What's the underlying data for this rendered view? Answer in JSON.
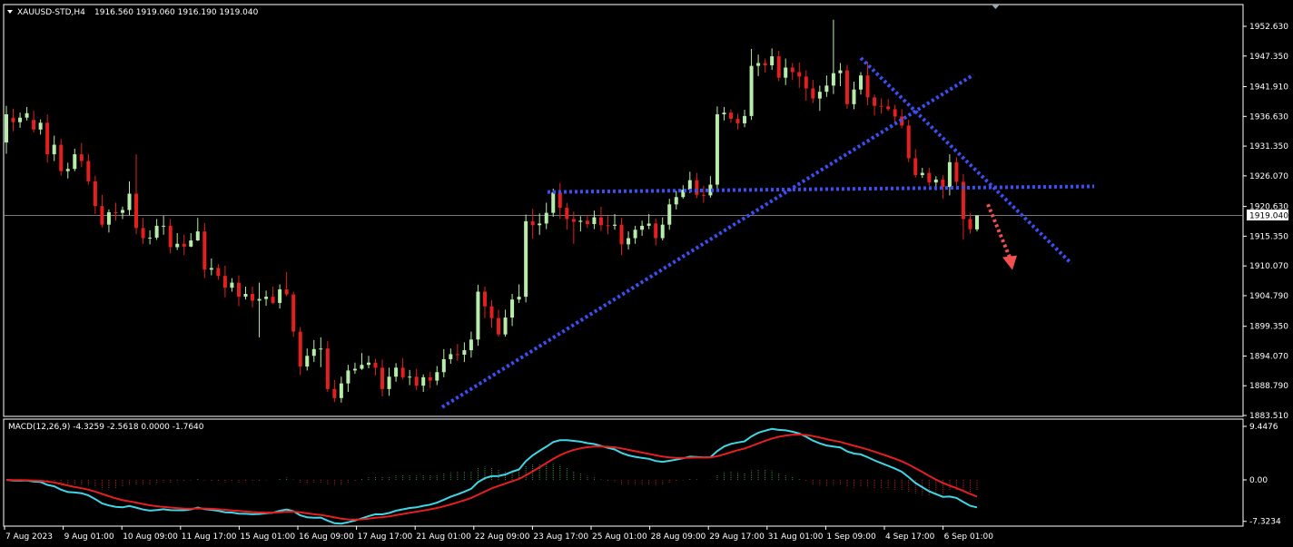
{
  "colors": {
    "background": "#000000",
    "frame": "#ffffff",
    "bull_candle": "#b7ecaa",
    "bear_candle": "#e41f1f",
    "trendline": "#3b4ff5",
    "arrow": "#f25050",
    "macd_line": "#40d6e6",
    "signal_line": "#e41f1f",
    "hist_pos": "#2f8f2f",
    "hist_neg": "#c41a1a",
    "price_line": "#a0a0a0"
  },
  "main_header": {
    "symbol_timeframe": "XAUUSD-STD,H4",
    "ohlc": "1916.560 1919.060 1916.190 1919.040"
  },
  "macd_header": {
    "text": "MACD(12,26,9) -4.3259 -2.5618 0.0000 -1.7640"
  },
  "current_price_label": "1919.040",
  "chart_data": [
    {
      "type": "candlestick",
      "title": "XAUUSD-STD,H4",
      "x_ticks": [
        "7 Aug 2023",
        "9 Aug 01:00",
        "10 Aug 09:00",
        "11 Aug 17:00",
        "15 Aug 01:00",
        "16 Aug 09:00",
        "17 Aug 17:00",
        "21 Aug 01:00",
        "22 Aug 09:00",
        "23 Aug 17:00",
        "25 Aug 01:00",
        "28 Aug 09:00",
        "29 Aug 17:00",
        "31 Aug 01:00",
        "1 Sep 09:00",
        "4 Sep 17:00",
        "6 Sep 01:00"
      ],
      "y_ticks": [
        "1952.630",
        "1947.350",
        "1941.910",
        "1936.630",
        "1931.350",
        "1926.070",
        "1920.630",
        "1915.350",
        "1910.070",
        "1904.790",
        "1899.350",
        "1894.070",
        "1888.790",
        "1883.510"
      ],
      "ylim": [
        1883.51,
        1955.5
      ],
      "current_price": 1919.04,
      "anchors": [
        1936,
        1936,
        1934,
        1927,
        1930,
        1921,
        1919,
        1915,
        1916,
        1921,
        1913,
        1915,
        1915,
        1909,
        1908,
        1905,
        1905,
        1903,
        1905,
        1902,
        1892,
        1894,
        1887,
        1891,
        1891,
        1892,
        1894,
        1897,
        1899,
        1906,
        1901,
        1897,
        1919,
        1917,
        1918,
        1919,
        1916,
        1919,
        1920,
        1918,
        1914,
        1917,
        1915,
        1922,
        1924,
        1937,
        1936,
        1947,
        1946,
        1944,
        1943,
        1943,
        1940,
        1941,
        1938,
        1928,
        1925,
        1917,
        1919.04
      ],
      "candles": [
        [
          1932.0,
          1937.0,
          1938.5,
          1930.0
        ],
        [
          1936.4,
          1935.6,
          1938.0,
          1934.0
        ],
        [
          1935.6,
          1936.4,
          1937.3,
          1934.6
        ],
        [
          1936.4,
          1937.2,
          1938.3,
          1935.9
        ],
        [
          1936.0,
          1934.3,
          1937.6,
          1933.8
        ],
        [
          1934.3,
          1935.5,
          1936.1,
          1933.4
        ],
        [
          1935.5,
          1929.9,
          1937.0,
          1928.4
        ],
        [
          1929.9,
          1931.6,
          1933.2,
          1928.7
        ],
        [
          1931.6,
          1926.9,
          1932.6,
          1926.1
        ],
        [
          1926.9,
          1927.3,
          1928.4,
          1925.6
        ],
        [
          1927.3,
          1929.9,
          1930.9,
          1926.9
        ],
        [
          1929.9,
          1928.7,
          1931.9,
          1927.6
        ],
        [
          1928.7,
          1925.1,
          1929.9,
          1924.5
        ],
        [
          1925.1,
          1920.7,
          1926.1,
          1919.3
        ],
        [
          1920.7,
          1917.4,
          1922.7,
          1916.9
        ],
        [
          1917.4,
          1919.6,
          1920.1,
          1916.0
        ],
        [
          1919.6,
          1919.5,
          1921.3,
          1918.1
        ],
        [
          1919.5,
          1920.0,
          1920.6,
          1918.4
        ],
        [
          1920.0,
          1922.9,
          1925.1,
          1919.1
        ],
        [
          1922.9,
          1916.8,
          1929.9,
          1915.7
        ],
        [
          1916.8,
          1915.0,
          1918.6,
          1914.0
        ],
        [
          1915.0,
          1915.1,
          1916.4,
          1913.9
        ],
        [
          1915.1,
          1917.2,
          1918.4,
          1914.7
        ],
        [
          1917.2,
          1917.2,
          1919.0,
          1915.6
        ],
        [
          1917.2,
          1913.4,
          1918.4,
          1912.3
        ],
        [
          1913.4,
          1914.0,
          1915.9,
          1912.9
        ],
        [
          1914.0,
          1913.5,
          1915.6,
          1912.0
        ],
        [
          1913.5,
          1914.6,
          1915.9,
          1913.4
        ],
        [
          1914.6,
          1916.2,
          1918.6,
          1914.5
        ],
        [
          1916.2,
          1909.4,
          1917.7,
          1907.9
        ],
        [
          1909.4,
          1909.7,
          1911.4,
          1908.4
        ],
        [
          1909.7,
          1908.3,
          1910.4,
          1907.6
        ],
        [
          1908.3,
          1906.2,
          1910.1,
          1904.5
        ],
        [
          1906.2,
          1907.1,
          1907.9,
          1905.5
        ],
        [
          1907.1,
          1904.6,
          1908.4,
          1902.9
        ],
        [
          1904.6,
          1905.1,
          1906.4,
          1904.1
        ],
        [
          1905.1,
          1903.9,
          1906.4,
          1902.7
        ],
        [
          1903.9,
          1904.2,
          1907.1,
          1897.4
        ],
        [
          1904.2,
          1904.6,
          1905.7,
          1903.0
        ],
        [
          1904.6,
          1903.5,
          1906.4,
          1903.3
        ],
        [
          1903.5,
          1905.9,
          1906.8,
          1902.5
        ],
        [
          1905.9,
          1905.0,
          1909.0,
          1904.7
        ],
        [
          1905.0,
          1898.4,
          1905.5,
          1897.5
        ],
        [
          1898.4,
          1892.2,
          1899.2,
          1890.7
        ],
        [
          1892.2,
          1894.1,
          1895.4,
          1891.5
        ],
        [
          1894.1,
          1895.3,
          1896.9,
          1893.0
        ],
        [
          1895.3,
          1895.4,
          1897.4,
          1892.1
        ],
        [
          1895.4,
          1888.2,
          1896.7,
          1887.7
        ],
        [
          1888.2,
          1886.6,
          1889.8,
          1885.9
        ],
        [
          1886.6,
          1889.2,
          1890.4,
          1885.8
        ],
        [
          1889.2,
          1891.5,
          1892.5,
          1887.7
        ],
        [
          1891.5,
          1891.8,
          1892.9,
          1890.9
        ],
        [
          1891.8,
          1892.5,
          1894.6,
          1891.6
        ],
        [
          1892.5,
          1892.9,
          1894.1,
          1891.9
        ],
        [
          1892.9,
          1892.0,
          1893.6,
          1890.6
        ],
        [
          1892.0,
          1888.2,
          1893.4,
          1886.9
        ],
        [
          1888.2,
          1890.4,
          1892.0,
          1887.0
        ],
        [
          1890.4,
          1892.0,
          1892.8,
          1889.5
        ],
        [
          1892.0,
          1890.3,
          1893.7,
          1889.9
        ],
        [
          1890.3,
          1890.4,
          1891.6,
          1888.9
        ],
        [
          1890.4,
          1888.8,
          1891.8,
          1888.0
        ],
        [
          1888.8,
          1890.3,
          1890.8,
          1887.7
        ],
        [
          1890.3,
          1889.7,
          1891.3,
          1888.4
        ],
        [
          1889.7,
          1891.2,
          1892.3,
          1888.9
        ],
        [
          1891.2,
          1893.5,
          1895.3,
          1890.3
        ],
        [
          1893.5,
          1894.4,
          1895.4,
          1892.7
        ],
        [
          1894.4,
          1894.3,
          1896.2,
          1893.2
        ],
        [
          1894.3,
          1895.1,
          1896.5,
          1893.0
        ],
        [
          1895.1,
          1897.0,
          1898.4,
          1893.8
        ],
        [
          1897.0,
          1905.5,
          1906.7,
          1895.9
        ],
        [
          1905.5,
          1902.9,
          1906.4,
          1900.8
        ],
        [
          1902.9,
          1900.8,
          1904.0,
          1899.1
        ],
        [
          1900.8,
          1897.9,
          1902.3,
          1897.5
        ],
        [
          1897.9,
          1900.9,
          1902.3,
          1897.5
        ],
        [
          1900.9,
          1904.1,
          1905.1,
          1899.4
        ],
        [
          1904.1,
          1904.6,
          1906.8,
          1903.5
        ],
        [
          1904.6,
          1918.0,
          1919.2,
          1903.6
        ],
        [
          1918.0,
          1917.3,
          1920.2,
          1914.9
        ],
        [
          1917.3,
          1917.6,
          1919.4,
          1915.6
        ],
        [
          1917.6,
          1919.5,
          1921.3,
          1916.6
        ],
        [
          1919.5,
          1923.1,
          1923.8,
          1918.8
        ],
        [
          1923.1,
          1920.4,
          1924.8,
          1918.4
        ],
        [
          1920.4,
          1918.4,
          1921.3,
          1916.5
        ],
        [
          1918.4,
          1917.9,
          1919.7,
          1914.0
        ],
        [
          1917.9,
          1918.1,
          1918.9,
          1916.2
        ],
        [
          1918.1,
          1917.5,
          1919.1,
          1916.8
        ],
        [
          1917.5,
          1918.7,
          1919.9,
          1916.6
        ],
        [
          1918.7,
          1917.3,
          1920.6,
          1916.3
        ],
        [
          1917.3,
          1917.2,
          1919.0,
          1915.7
        ],
        [
          1917.2,
          1917.4,
          1919.3,
          1916.5
        ],
        [
          1917.4,
          1913.9,
          1918.6,
          1912.0
        ],
        [
          1913.9,
          1915.0,
          1916.2,
          1913.0
        ],
        [
          1915.0,
          1916.5,
          1917.2,
          1914.0
        ],
        [
          1916.5,
          1917.2,
          1918.1,
          1915.4
        ],
        [
          1917.2,
          1917.6,
          1919.3,
          1916.6
        ],
        [
          1917.6,
          1915.0,
          1918.5,
          1913.7
        ],
        [
          1915.0,
          1917.4,
          1918.7,
          1914.6
        ],
        [
          1917.4,
          1921.0,
          1922.0,
          1916.5
        ],
        [
          1921.0,
          1922.3,
          1923.4,
          1920.1
        ],
        [
          1922.3,
          1923.6,
          1924.4,
          1922.0
        ],
        [
          1923.6,
          1925.3,
          1926.8,
          1923.0
        ],
        [
          1925.3,
          1922.7,
          1926.6,
          1922.1
        ],
        [
          1922.7,
          1922.6,
          1924.3,
          1921.3
        ],
        [
          1922.6,
          1924.5,
          1926.0,
          1922.2
        ],
        [
          1924.5,
          1937.0,
          1938.4,
          1923.7
        ],
        [
          1937.0,
          1937.3,
          1938.3,
          1935.9
        ],
        [
          1937.3,
          1936.2,
          1937.9,
          1935.5
        ],
        [
          1936.2,
          1935.4,
          1937.1,
          1934.3
        ],
        [
          1935.4,
          1936.7,
          1937.8,
          1934.7
        ],
        [
          1936.7,
          1945.6,
          1948.6,
          1936.0
        ],
        [
          1945.6,
          1946.1,
          1947.6,
          1943.8
        ],
        [
          1946.1,
          1945.7,
          1946.9,
          1944.4
        ],
        [
          1945.7,
          1947.3,
          1948.7,
          1944.9
        ],
        [
          1947.3,
          1943.5,
          1948.3,
          1942.9
        ],
        [
          1943.5,
          1945.3,
          1946.9,
          1942.2
        ],
        [
          1945.3,
          1944.5,
          1946.1,
          1943.1
        ],
        [
          1944.5,
          1943.7,
          1946.2,
          1941.7
        ],
        [
          1943.7,
          1941.6,
          1944.8,
          1939.4
        ],
        [
          1941.6,
          1939.8,
          1943.1,
          1939.0
        ],
        [
          1939.8,
          1941.0,
          1942.1,
          1937.6
        ],
        [
          1941.0,
          1942.1,
          1943.9,
          1940.1
        ],
        [
          1942.1,
          1944.3,
          1953.8,
          1940.6
        ],
        [
          1944.3,
          1944.8,
          1946.1,
          1942.0
        ],
        [
          1944.8,
          1938.8,
          1945.8,
          1938.0
        ],
        [
          1938.8,
          1941.4,
          1942.8,
          1937.9
        ],
        [
          1941.4,
          1943.9,
          1944.5,
          1940.5
        ],
        [
          1943.9,
          1940.0,
          1946.3,
          1938.6
        ],
        [
          1940.0,
          1938.5,
          1940.5,
          1936.8
        ],
        [
          1938.5,
          1938.4,
          1939.8,
          1937.1
        ],
        [
          1938.4,
          1937.9,
          1939.7,
          1937.6
        ],
        [
          1937.9,
          1936.6,
          1938.7,
          1935.5
        ],
        [
          1936.6,
          1935.0,
          1937.9,
          1934.5
        ],
        [
          1935.0,
          1929.2,
          1936.0,
          1928.5
        ],
        [
          1929.2,
          1926.2,
          1930.8,
          1925.8
        ],
        [
          1926.2,
          1926.6,
          1927.5,
          1925.7
        ],
        [
          1926.6,
          1924.9,
          1927.5,
          1924.3
        ],
        [
          1924.9,
          1925.4,
          1926.0,
          1923.5
        ],
        [
          1925.4,
          1924.1,
          1926.2,
          1922.0
        ],
        [
          1924.1,
          1928.5,
          1929.9,
          1922.6
        ],
        [
          1928.5,
          1925.0,
          1929.4,
          1923.7
        ],
        [
          1925.0,
          1918.4,
          1926.4,
          1914.8
        ],
        [
          1918.4,
          1916.6,
          1919.4,
          1915.8
        ],
        [
          1916.56,
          1919.04,
          1919.06,
          1916.19
        ]
      ]
    },
    {
      "type": "macd",
      "title": "MACD(12,26,9)",
      "params": [
        12,
        26,
        9
      ],
      "values": {
        "macd": -4.3259,
        "signal": -2.5618,
        "histogram": 0.0,
        "osma": -1.764
      },
      "y_ticks": [
        "9.4476",
        "0.00",
        "-7.3234"
      ],
      "ylim": [
        -7.3234,
        9.4476
      ]
    }
  ],
  "annotations": {
    "lines": [
      {
        "name": "support-trendline",
        "from": [
          "21 Aug 01:00",
          1885.0
        ],
        "to": [
          "4 Sep 17:00",
          1944.0
        ]
      },
      {
        "name": "resistance-horizontal-line",
        "from": [
          "23 Aug 17:00",
          1923.2
        ],
        "to": [
          "7 Sep 05:00",
          1924.2
        ]
      },
      {
        "name": "downtrend-line",
        "from": [
          "1 Sep 09:00",
          1947.0
        ],
        "to": [
          "7 Sep 05:00",
          1910.5
        ]
      }
    ],
    "arrow": {
      "name": "bearish-arrow",
      "from": [
        1070,
        1921.0
      ],
      "to": [
        1110,
        1910.0
      ]
    }
  }
}
